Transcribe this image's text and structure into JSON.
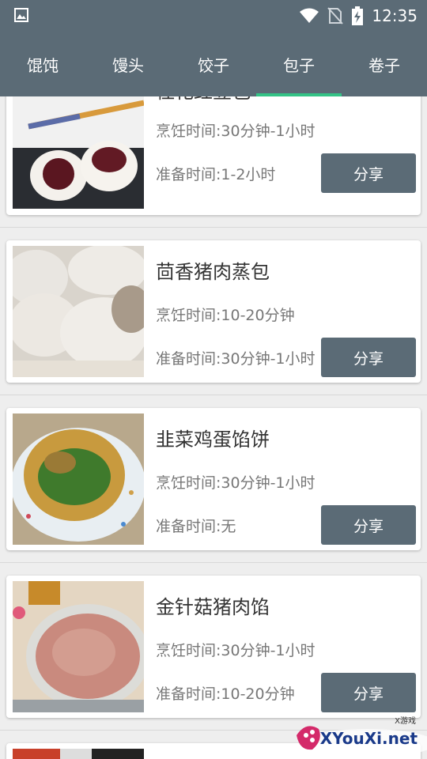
{
  "status": {
    "time": "12:35"
  },
  "tabs": [
    {
      "label": "馄饨"
    },
    {
      "label": "馒头"
    },
    {
      "label": "饺子"
    },
    {
      "label": "包子"
    },
    {
      "label": "卷子"
    }
  ],
  "active_tab": "包子",
  "cards": [
    {
      "title": "桂花红豆包",
      "cook": "烹饪时间:30分钟-1小时",
      "prep": "准备时间:1-2小时",
      "share": "分享"
    },
    {
      "title": "茴香猪肉蒸包",
      "cook": "烹饪时间:10-20分钟",
      "prep": "准备时间:30分钟-1小时",
      "share": "分享"
    },
    {
      "title": "韭菜鸡蛋馅饼",
      "cook": "烹饪时间:30分钟-1小时",
      "prep": "准备时间:无",
      "share": "分享"
    },
    {
      "title": "金针菇猪肉馅",
      "cook": "烹饪时间:30分钟-1小时",
      "prep": "准备时间:10-20分钟",
      "share": "分享"
    }
  ],
  "watermark": {
    "site": "XYouXi.net",
    "small": "X游戏"
  }
}
